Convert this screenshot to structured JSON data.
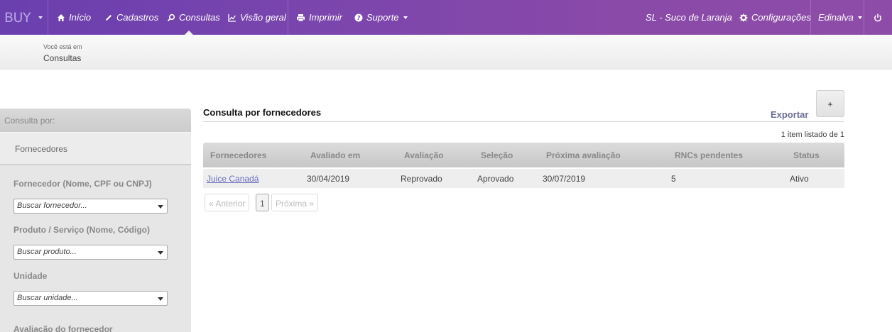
{
  "brand": {
    "logo": "BUY"
  },
  "nav": {
    "inicio": "Início",
    "cadastros": "Cadastros",
    "consultas": "Consultas",
    "visao_geral": "Visão geral",
    "imprimir": "Imprimir",
    "suporte": "Suporte",
    "company": "SL - Suco de Laranja",
    "configuracoes": "Configurações",
    "user": "Edinalva"
  },
  "breadcrumb": {
    "prefix": "Você está em",
    "current": "Consultas"
  },
  "sidebar": {
    "header": "Consulta por:",
    "tab": "Fornecedores",
    "fields": [
      {
        "label": "Fornecedor (Nome, CPF ou CNPJ)",
        "placeholder": "Buscar fornecedor..."
      },
      {
        "label": "Produto / Serviço (Nome, Código)",
        "placeholder": "Buscar produto..."
      },
      {
        "label": "Unidade",
        "placeholder": "Buscar unidade..."
      },
      {
        "label": "Avaliação do fornecedor"
      }
    ]
  },
  "main": {
    "title": "Consulta por fornecedores",
    "export_label": "Exportar",
    "add_label": "+",
    "count_text": "1 item listado de 1",
    "columns": [
      "Fornecedores",
      "Avaliado em",
      "Avaliação",
      "Seleção",
      "Próxima avaliação",
      "RNCs pendentes",
      "Status"
    ],
    "rows": [
      [
        "Juice Canadá",
        "30/04/2019",
        "Reprovado",
        "Aprovado",
        "30/07/2019",
        "5",
        "Ativo"
      ]
    ],
    "pagination": {
      "prev": "« Anterior",
      "page": "1",
      "next": "Próxima »"
    }
  },
  "colors": {
    "nav_start": "#6a3fae",
    "nav_end": "#8d4ca7",
    "link": "#6b6ec0",
    "export": "#6b6e94"
  }
}
